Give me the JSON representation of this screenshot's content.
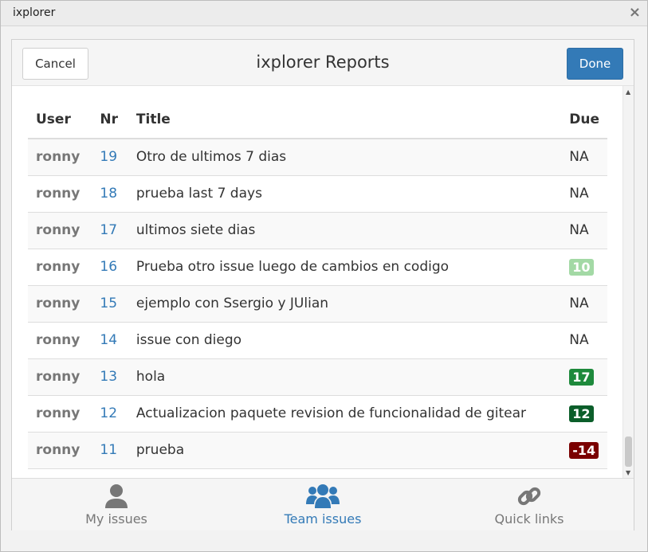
{
  "window": {
    "title": "ixplorer",
    "close_glyph": "×"
  },
  "header": {
    "cancel_label": "Cancel",
    "title": "ixplorer Reports",
    "done_label": "Done"
  },
  "table": {
    "columns": [
      "User",
      "Nr",
      "Title",
      "Due"
    ],
    "rows": [
      {
        "user": "ronny",
        "nr": "19",
        "title": "Otro de ultimos 7 dias",
        "due": "NA",
        "due_badge": false
      },
      {
        "user": "ronny",
        "nr": "18",
        "title": "prueba last 7 days",
        "due": "NA",
        "due_badge": false
      },
      {
        "user": "ronny",
        "nr": "17",
        "title": "ultimos siete dias",
        "due": "NA",
        "due_badge": false
      },
      {
        "user": "ronny",
        "nr": "16",
        "title": "Prueba otro issue luego de cambios en codigo",
        "due": "10",
        "due_badge": true,
        "badge_color": "#a3d9a5"
      },
      {
        "user": "ronny",
        "nr": "15",
        "title": "ejemplo con Ssergio y JUlian",
        "due": "NA",
        "due_badge": false
      },
      {
        "user": "ronny",
        "nr": "14",
        "title": "issue con diego",
        "due": "NA",
        "due_badge": false
      },
      {
        "user": "ronny",
        "nr": "13",
        "title": "hola",
        "due": "17",
        "due_badge": true,
        "badge_color": "#1e8a3c"
      },
      {
        "user": "ronny",
        "nr": "12",
        "title": "Actualizacion paquete revision de funcionalidad de gitear",
        "due": "12",
        "due_badge": true,
        "badge_color": "#0b5e2a"
      },
      {
        "user": "ronny",
        "nr": "11",
        "title": "prueba",
        "due": "-14",
        "due_badge": true,
        "badge_color": "#7a0000"
      }
    ]
  },
  "tabs": [
    {
      "label": "My issues",
      "icon": "user-icon",
      "active": false
    },
    {
      "label": "Team issues",
      "icon": "users-icon",
      "active": true
    },
    {
      "label": "Quick links",
      "icon": "link-icon",
      "active": false
    }
  ],
  "colors": {
    "accent": "#337ab7",
    "muted": "#777777"
  }
}
